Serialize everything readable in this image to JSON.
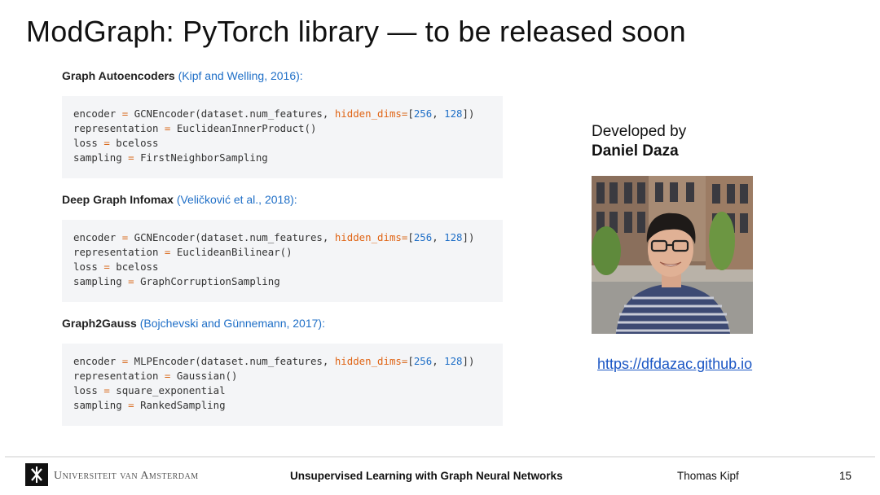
{
  "slide": {
    "title": "ModGraph: PyTorch library — to be released soon"
  },
  "models": [
    {
      "name": "Graph Autoencoders",
      "citation": "(Kipf and Welling, 2016)",
      "code": {
        "encoder_class": "GCNEncoder",
        "representation": "EuclideanInnerProduct()",
        "loss": "bceloss",
        "sampling": "FirstNeighborSampling"
      }
    },
    {
      "name": "Deep Graph Infomax",
      "citation": "(Veličković et al., 2018)",
      "code": {
        "encoder_class": "GCNEncoder",
        "representation": "EuclideanBilinear()",
        "loss": "bceloss",
        "sampling": "GraphCorruptionSampling"
      }
    },
    {
      "name": "Graph2Gauss",
      "citation": "(Bojchevski and Günnemann, 2017)",
      "code": {
        "encoder_class": "MLPEncoder",
        "representation": "Gaussian()",
        "loss": "square_exponential",
        "sampling": "RankedSampling"
      }
    }
  ],
  "code_common": {
    "encoder_var": "encoder",
    "representation_var": "representation",
    "loss_var": "loss",
    "sampling_var": "sampling",
    "eq": "=",
    "args_prefix": "(dataset.num_features, ",
    "kwarg": "hidden_dims",
    "list_open": "[",
    "dim1": "256",
    "sep": ", ",
    "dim2": "128",
    "list_close": "])"
  },
  "developer": {
    "label": "Developed by",
    "name": "Daniel Daza",
    "url": "https://dfdazac.github.io"
  },
  "footer": {
    "institution": "Universiteit van Amsterdam",
    "talk_title": "Unsupervised Learning with Graph Neural Networks",
    "author": "Thomas Kipf",
    "page": "15"
  }
}
